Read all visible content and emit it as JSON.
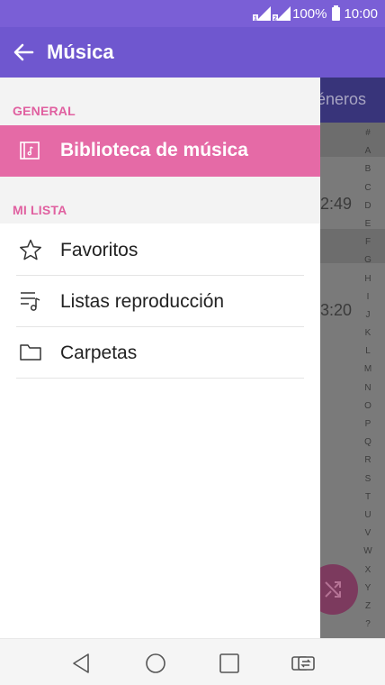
{
  "status_bar": {
    "battery_text": "100%",
    "time": "10:00"
  },
  "app_bar": {
    "title": "Música"
  },
  "drawer": {
    "general_label": "GENERAL",
    "active_item": "Biblioteca de música",
    "mi_lista_label": "MI LISTA",
    "items": [
      {
        "label": "Favoritos",
        "icon": "star-icon"
      },
      {
        "label": "Listas reproducción",
        "icon": "playlist-icon"
      },
      {
        "label": "Carpetas",
        "icon": "folder-icon"
      }
    ]
  },
  "background": {
    "tab_partial": "éneros",
    "durations": [
      "2:49",
      "3:20"
    ],
    "index_letters": [
      "#",
      "A",
      "B",
      "C",
      "D",
      "E",
      "F",
      "G",
      "H",
      "I",
      "J",
      "K",
      "L",
      "M",
      "N",
      "O",
      "P",
      "Q",
      "R",
      "S",
      "T",
      "U",
      "V",
      "W",
      "X",
      "Y",
      "Z",
      "?"
    ]
  },
  "nav_bar": {
    "buttons": [
      "back-icon",
      "home-icon",
      "recents-icon",
      "switch-sim-icon"
    ]
  }
}
